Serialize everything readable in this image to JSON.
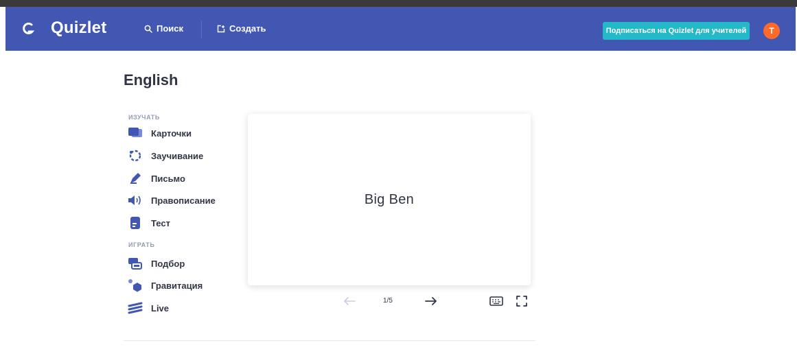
{
  "colors": {
    "navbar": "#4257b2",
    "accent": "#23b9c9",
    "avatar": "#ff6a2a",
    "mode_icon": "#4257b2",
    "text": "#303545",
    "muted": "#939bb4"
  },
  "header": {
    "back_icon": "back-g-icon",
    "logo": "Quizlet",
    "search_icon": "search-icon",
    "search_label": "Поиск",
    "create_icon": "create-icon",
    "create_label": "Создать",
    "teacher_button": "Подписаться на Quizlet для учителей",
    "avatar_letter": "T"
  },
  "set": {
    "title": "English"
  },
  "study": {
    "label": "ИЗУЧАТЬ",
    "modes": [
      {
        "icon": "cards-icon",
        "label": "Карточки"
      },
      {
        "icon": "learn-icon",
        "label": "Заучивание"
      },
      {
        "icon": "write-icon",
        "label": "Письмо"
      },
      {
        "icon": "spell-icon",
        "label": "Правописание"
      },
      {
        "icon": "test-icon",
        "label": "Тест"
      }
    ]
  },
  "play": {
    "label": "ИГРАТЬ",
    "modes": [
      {
        "icon": "match-icon",
        "label": "Подбор"
      },
      {
        "icon": "gravity-icon",
        "label": "Гравитация"
      },
      {
        "icon": "live-icon",
        "label": "Live"
      }
    ]
  },
  "flashcard": {
    "term": "Big Ben",
    "counter": "1/5",
    "prev_icon": "arrow-left-icon",
    "next_icon": "arrow-right-icon",
    "keyboard_icon": "keyboard-icon",
    "fullscreen_icon": "fullscreen-icon"
  }
}
